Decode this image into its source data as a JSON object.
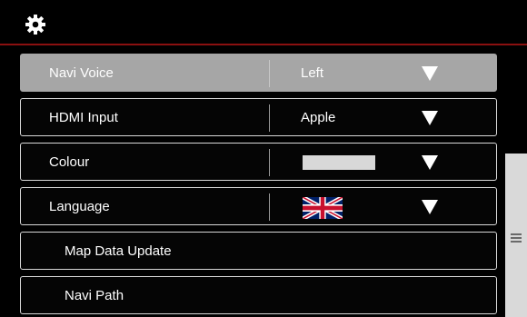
{
  "header": {
    "icon": "gear-icon"
  },
  "rows": [
    {
      "label": "Navi Voice",
      "value": "Left",
      "active": true
    },
    {
      "label": "HDMI Input",
      "value": "Apple"
    },
    {
      "label": "Colour",
      "swatch_color": "#d8d8d8"
    },
    {
      "label": "Language",
      "flag": "uk-flag-icon"
    },
    {
      "label": "Map Data Update"
    },
    {
      "label": "Navi Path"
    }
  ],
  "colors": {
    "background": "#000000",
    "active_row": "#a6a6a6",
    "accent_line": "#8a1010",
    "scroll_thumb": "#d9d9d9"
  }
}
